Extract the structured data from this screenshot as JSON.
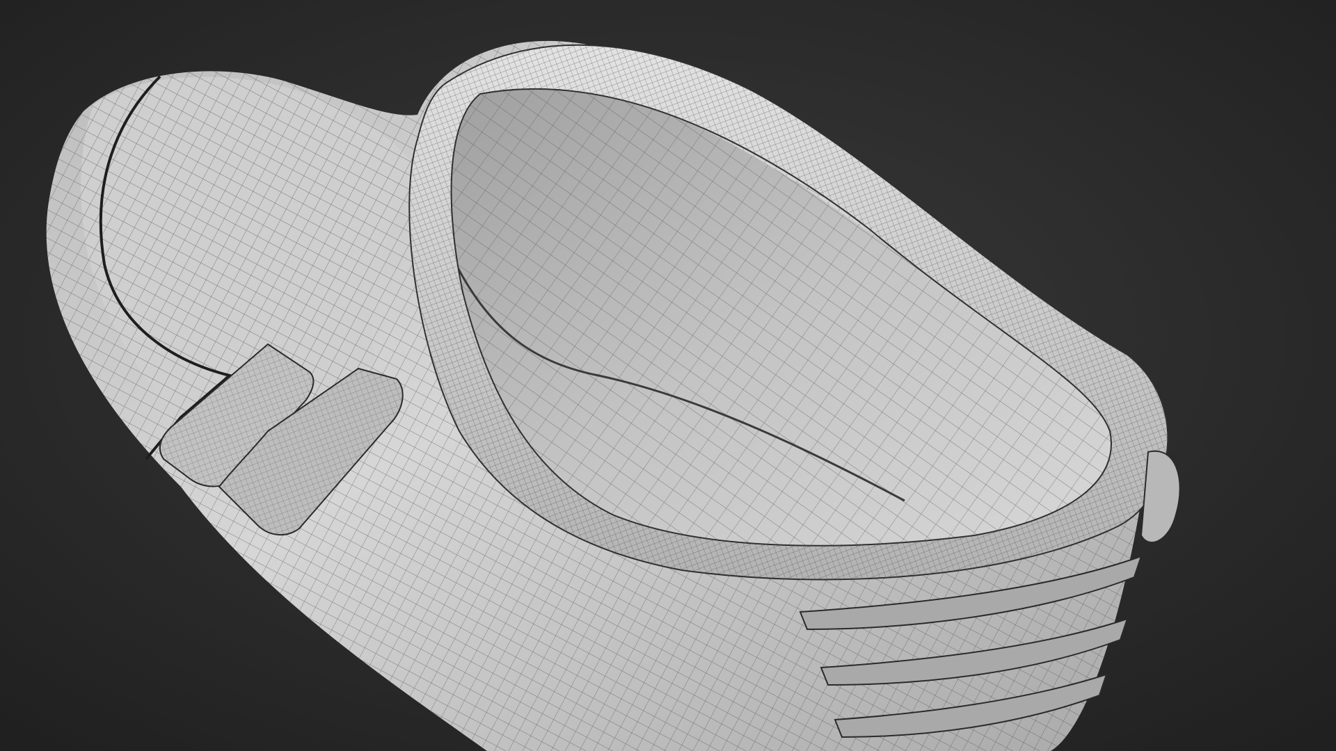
{
  "scene": {
    "subject": "clog-shoe-mesh",
    "background_color": "#2b2b2b",
    "surface_color": "#c9c9c9",
    "wire_color": "#3a3a3a",
    "seam_color": "#1e1e1e"
  }
}
